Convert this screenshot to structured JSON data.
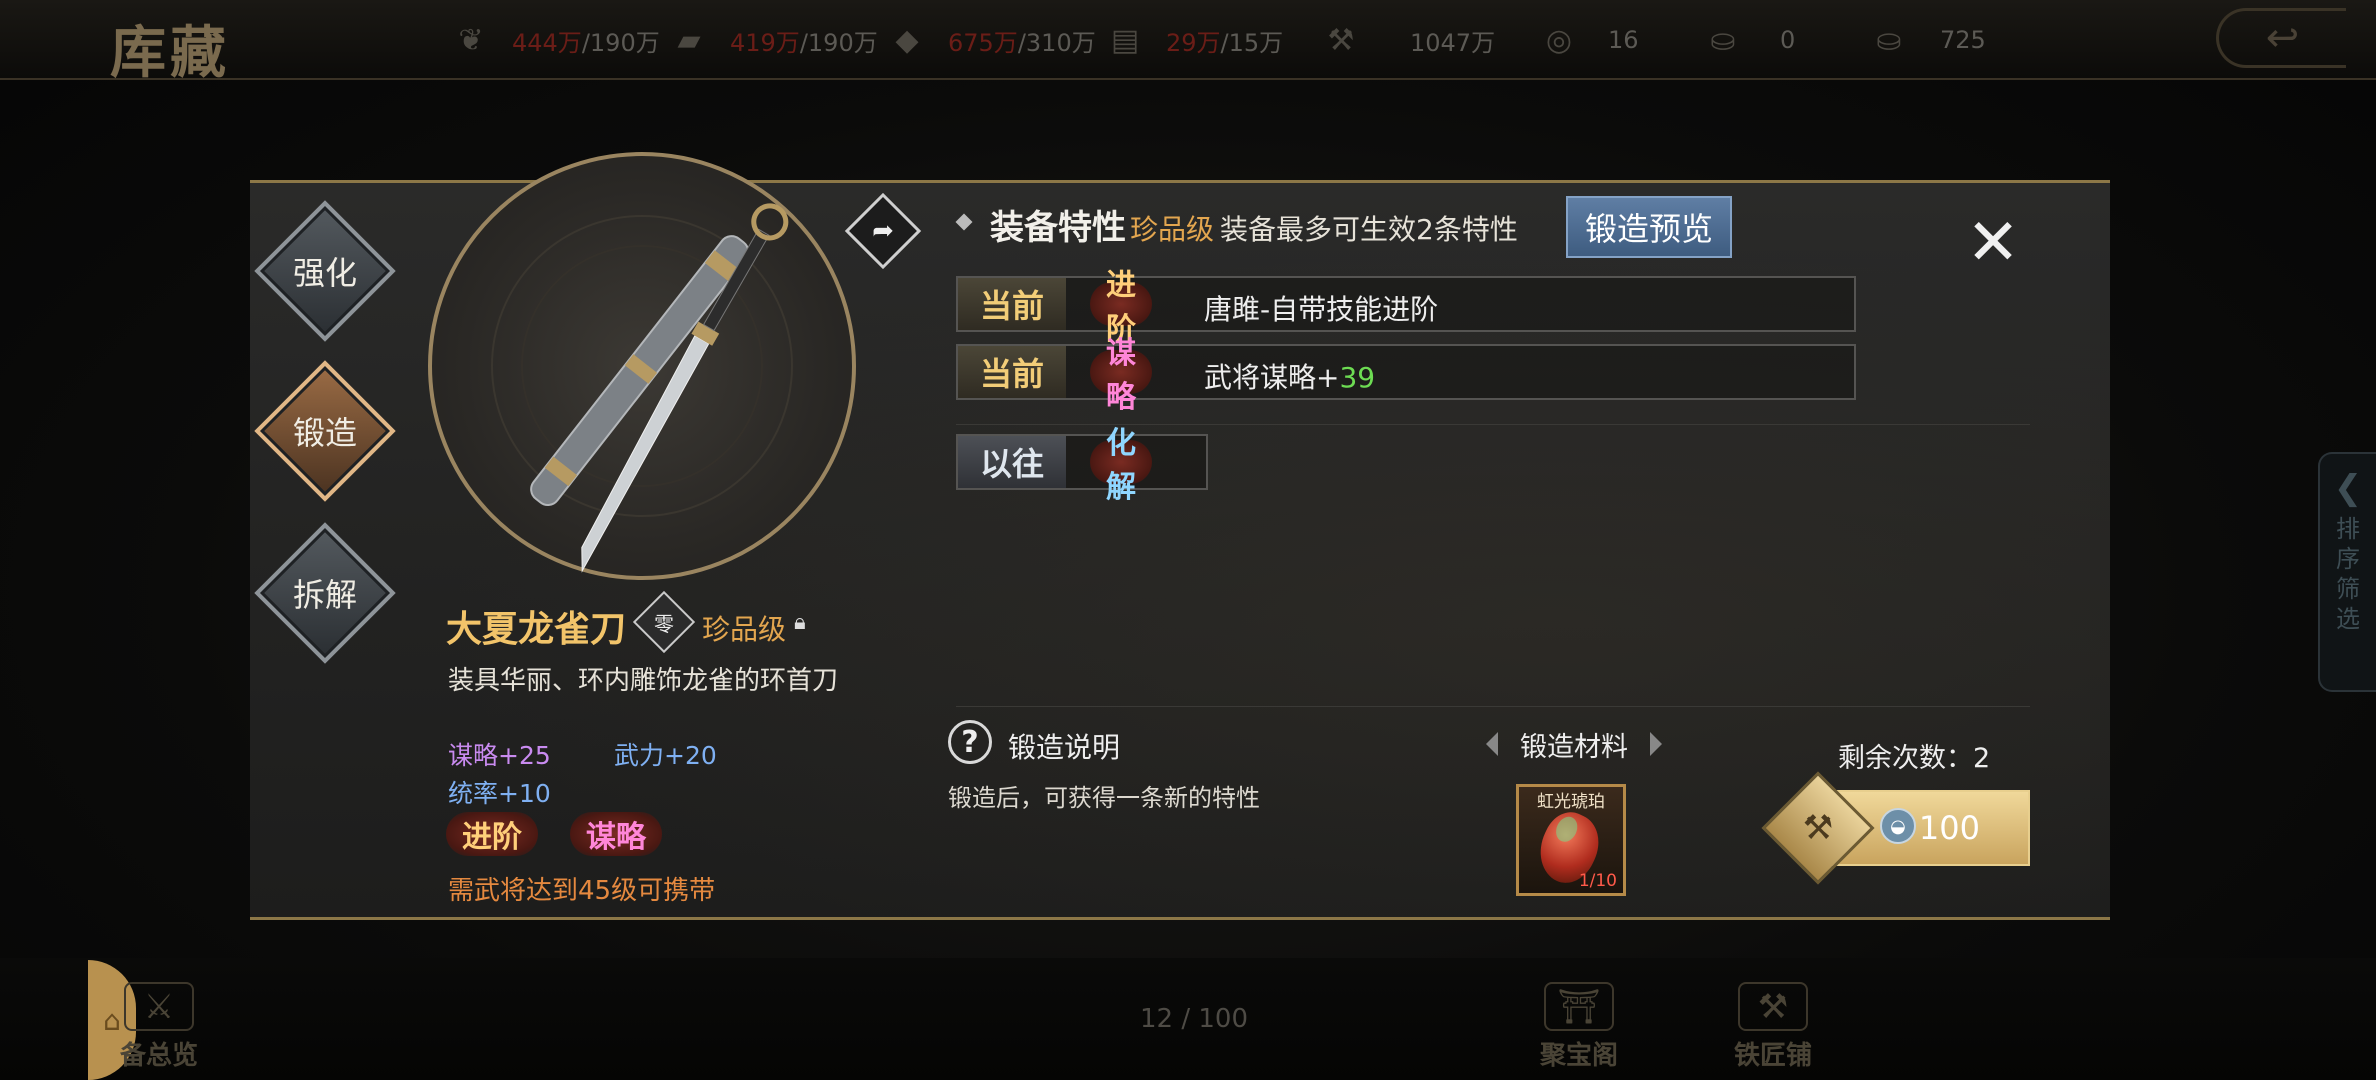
{
  "header": {
    "logo": "库藏",
    "resources": [
      {
        "icon": "grain-icon",
        "current": "444万",
        "cap": "/190万"
      },
      {
        "icon": "wood-icon",
        "current": "419万",
        "cap": "/190万"
      },
      {
        "icon": "stone-icon",
        "current": "675万",
        "cap": "/310万"
      },
      {
        "icon": "iron-icon",
        "current": "29万",
        "cap": "/15万"
      },
      {
        "icon": "copper-icon",
        "current": "",
        "cap": "1047万"
      },
      {
        "icon": "coin-icon",
        "current": "",
        "cap": "16"
      },
      {
        "icon": "gold-ingot-icon",
        "current": "",
        "cap": "0"
      },
      {
        "icon": "silver-ingot-icon",
        "current": "",
        "cap": "725"
      }
    ],
    "back_icon": "↩"
  },
  "actions": {
    "enhance": "强化",
    "forge": "锻造",
    "dismantle": "拆解"
  },
  "item": {
    "name": "大夏龙雀刀",
    "badge": "零",
    "grade": "珍品级",
    "description": "装具华丽、环内雕饰龙雀的环首刀",
    "stats": {
      "strategy": "谋略+25",
      "force": "武力+20",
      "command": "统率+10"
    },
    "tags": [
      "进阶",
      "谋略"
    ],
    "requirement": "需武将达到45级可携带"
  },
  "traits": {
    "title": "装备特性",
    "grade": "珍品级",
    "note": "装备最多可生效2条特性",
    "preview_button": "锻造预览",
    "rows": [
      {
        "label": "当前",
        "tag": "进阶",
        "text": "唐雎-自带技能进阶",
        "num": ""
      },
      {
        "label": "当前",
        "tag": "谋略",
        "text": "武将谋略+",
        "num": "39"
      }
    ],
    "past": {
      "label": "以往",
      "tag": "化解"
    }
  },
  "forge": {
    "help_label": "锻造说明",
    "help_desc": "锻造后，可获得一条新的特性",
    "materials_label": "锻造材料",
    "material_name": "虹光琥珀",
    "material_count": "1/10",
    "remaining": "剩余次数：2",
    "cost": "100"
  },
  "footer": {
    "page_count": "12 / 100",
    "overview": "备总览",
    "treasure": "聚宝阁",
    "smithy": "铁匠铺"
  },
  "side_filter": {
    "label": "排序筛选"
  }
}
